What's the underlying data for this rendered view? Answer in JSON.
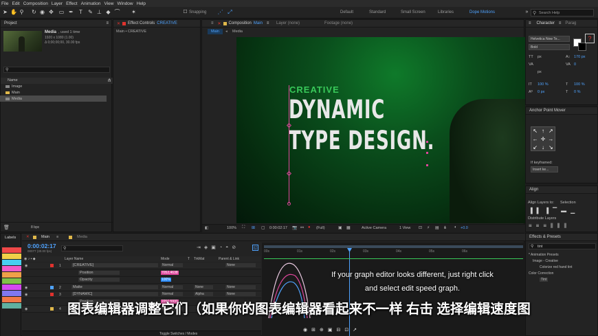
{
  "menu": [
    "File",
    "Edit",
    "Composition",
    "Layer",
    "Effect",
    "Animation",
    "View",
    "Window",
    "Help"
  ],
  "toolbar": {
    "snapping_label": "Snapping",
    "workspaces": [
      "Default",
      "Standard",
      "Small Screen",
      "Libraries",
      "Dope Motions"
    ],
    "search_placeholder": "Search Help"
  },
  "project": {
    "title": "Project",
    "item_name": "Media",
    "used": ", used 1 time",
    "dims": "1920 x 1080 (1.00)",
    "duration": "Δ 0;00;00;00, 30.00 fps",
    "name_col": "Name",
    "items": [
      "Image",
      "Main",
      "Media"
    ],
    "bpc": "8 bpc"
  },
  "effect_controls": {
    "title": "Effect Controls",
    "layer": "CREATIVE",
    "breadcrumb": "Main • CREATIVE"
  },
  "composition": {
    "tab_prefix": "Composition",
    "tab_name": "Main",
    "layer_tab": "Layer  (none)",
    "footage_tab": "Footage  (none)",
    "subtabs": [
      "Main",
      "Media"
    ],
    "text_creative": "CREATIVE",
    "text_line1": "DYNAMIC",
    "text_line2": "TYPE DESIGN.",
    "zoom": "100%",
    "time": "0:00:02:17",
    "quality": "(Full)",
    "camera": "Active Camera",
    "view": "1 View",
    "exposure": "+0.0"
  },
  "character": {
    "tab": "Character",
    "tab2": "Parag",
    "font": "Helvetica Now Te...",
    "style": "Bold",
    "size_unit": "px",
    "leading": "170 px",
    "tracking": "0",
    "percent_a": "100 %",
    "percent_b": "100 %",
    "baseline": "0 px",
    "tsume": "0 %"
  },
  "anchor": {
    "title": "Anchor Point Mover",
    "if_keyframed": "If keyframed:",
    "insert": "Insert ke..."
  },
  "align": {
    "title": "Align",
    "align_to_label": "Align Layers to:",
    "align_to_value": "Selection",
    "distribute": "Distribute Layers"
  },
  "effects_presets": {
    "title": "Effects & Presets",
    "search": "tint",
    "items": [
      "* Animation Presets",
      "Image - Creative",
      "Colorize red hand tint",
      "Color Correction",
      "Tint"
    ]
  },
  "timeline": {
    "labels_title": "Labels",
    "tabs": [
      "Main",
      "Media"
    ],
    "time": "0:00:02:17",
    "time_sub": "00077 (30.00 fps)",
    "col_layer": "Layer Name",
    "col_mode": "Mode",
    "col_t": "T",
    "col_trkmat": "TrkMat",
    "col_parent": "Parent & Link",
    "rulers": [
      "00s",
      "01s",
      "02s",
      "03s",
      "04s",
      "05s",
      "06s"
    ],
    "layers": [
      {
        "num": "1",
        "name": "[CREATIVE]",
        "mode": "Normal",
        "parent": "None"
      },
      {
        "num": "",
        "name": "Position",
        "mode": "",
        "value": "7052,4638"
      },
      {
        "num": "",
        "name": "Opacity",
        "mode": "",
        "value": "100%"
      },
      {
        "num": "2",
        "name": "Matte",
        "mode": "Normal",
        "trk": "None",
        "parent": "None"
      },
      {
        "num": "3",
        "name": "[DYNAMIC]",
        "mode": "Normal",
        "trk": "Alpha",
        "parent": "None"
      },
      {
        "num": "",
        "name": "Position",
        "mode": "",
        "value": "2256,5930"
      },
      {
        "num": "4",
        "name": "[Media]",
        "mode": "Normal",
        "parent": "None"
      }
    ],
    "toggle": "Toggle Switches / Modes"
  },
  "label_colors": [
    "#f04848",
    "#f0d048",
    "#48d0f0",
    "#f05bc8",
    "#f0a048",
    "#80c048",
    "#d448f0",
    "#8078f0",
    "#f07848",
    "#60b0a0"
  ],
  "subtitles": {
    "english_line1": "If your graph editor looks different, just right click",
    "english_line2": "and select edit speed graph.",
    "chinese": "图表编辑器调整它们（如果你的图表编辑器看起来不一样 右击 选择编辑速度图"
  },
  "accent_colors": {
    "blue": "#2b8cff",
    "green": "#39c95a",
    "pink": "#e0479c",
    "red": "#e0322e"
  }
}
